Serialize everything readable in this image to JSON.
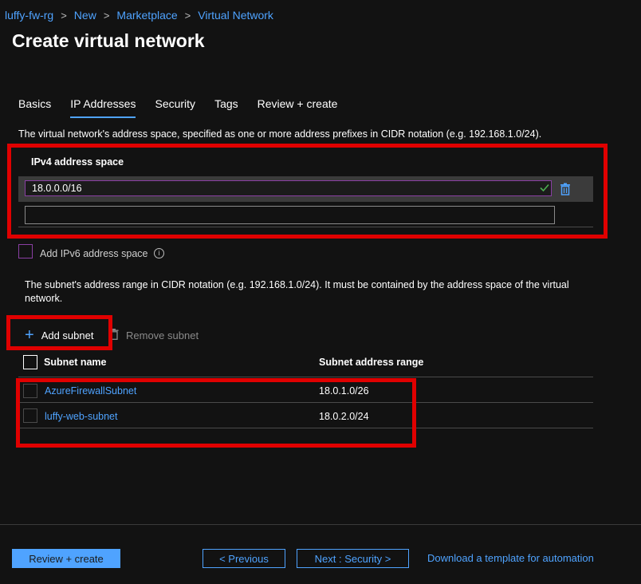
{
  "breadcrumb": {
    "items": [
      "luffy-fw-rg",
      "New",
      "Marketplace",
      "Virtual Network"
    ],
    "separator": ">"
  },
  "page": {
    "title": "Create virtual network"
  },
  "tabs": [
    {
      "label": "Basics",
      "active": false
    },
    {
      "label": "IP Addresses",
      "active": true
    },
    {
      "label": "Security",
      "active": false
    },
    {
      "label": "Tags",
      "active": false
    },
    {
      "label": "Review + create",
      "active": false
    }
  ],
  "address_space": {
    "description": "The virtual network's address space, specified as one or more address prefixes in CIDR notation (e.g. 192.168.1.0/24).",
    "section_label": "IPv4 address space",
    "value": "18.0.0.0/16",
    "empty_value": ""
  },
  "ipv6": {
    "label": "Add IPv6 address space",
    "checked": false
  },
  "subnets": {
    "description": "The subnet's address range in CIDR notation (e.g. 192.168.1.0/24). It must be contained by the address space of the virtual network.",
    "add_label": "Add subnet",
    "remove_label": "Remove subnet",
    "columns": [
      "Subnet name",
      "Subnet address range"
    ],
    "rows": [
      {
        "name": "AzureFirewallSubnet",
        "range": "18.0.1.0/26"
      },
      {
        "name": "luffy-web-subnet",
        "range": "18.0.2.0/24"
      }
    ]
  },
  "footer": {
    "review_create": "Review + create",
    "previous": "< Previous",
    "next": "Next : Security >",
    "download": "Download a template for automation"
  },
  "colors": {
    "accent": "#4fa3ff",
    "annotation": "#e00000",
    "background": "#121212",
    "input_border": "#8a3fa3",
    "valid": "#4caf50"
  },
  "icons": {
    "chevron": "chevron-right-icon",
    "valid": "checkmark-icon",
    "delete": "trash-icon",
    "info": "info-icon",
    "add": "plus-icon",
    "remove": "trash-icon"
  }
}
